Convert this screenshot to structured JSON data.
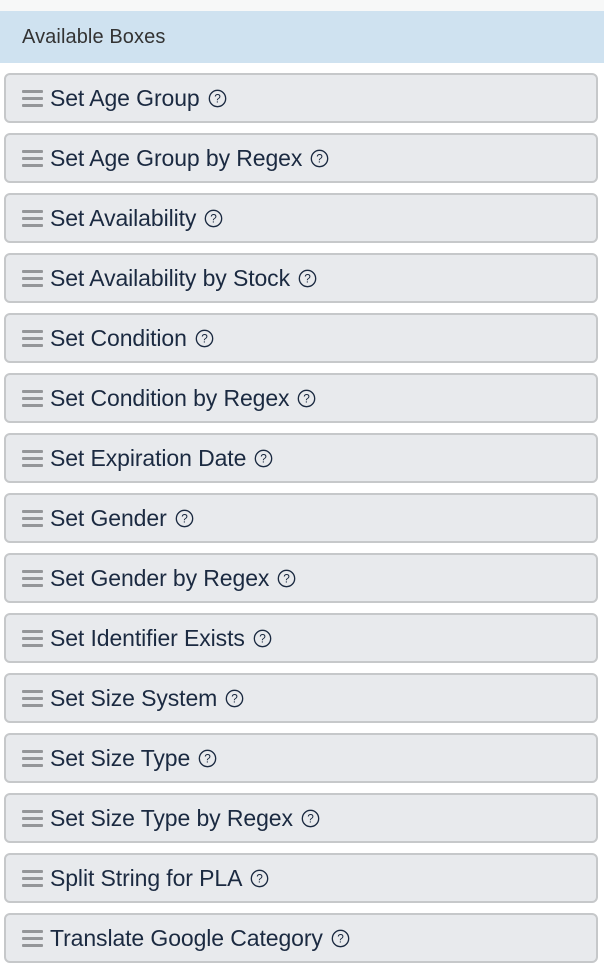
{
  "panel": {
    "header": {
      "title": "Available Boxes",
      "background_color": "#cfe2f0",
      "text_color": "#333333"
    },
    "item_style": {
      "background_color": "#e8eaed",
      "border_color": "#c6c8ca",
      "text_color": "#1b2a41",
      "handle_color": "#949699"
    },
    "items": [
      {
        "label": "Set Age Group",
        "drag_handle_icon": "drag-handle-icon",
        "help_icon": "help-circle-icon"
      },
      {
        "label": "Set Age Group by Regex",
        "drag_handle_icon": "drag-handle-icon",
        "help_icon": "help-circle-icon"
      },
      {
        "label": "Set Availability",
        "drag_handle_icon": "drag-handle-icon",
        "help_icon": "help-circle-icon"
      },
      {
        "label": "Set Availability by Stock",
        "drag_handle_icon": "drag-handle-icon",
        "help_icon": "help-circle-icon"
      },
      {
        "label": "Set Condition",
        "drag_handle_icon": "drag-handle-icon",
        "help_icon": "help-circle-icon"
      },
      {
        "label": "Set Condition by Regex",
        "drag_handle_icon": "drag-handle-icon",
        "help_icon": "help-circle-icon"
      },
      {
        "label": "Set Expiration Date",
        "drag_handle_icon": "drag-handle-icon",
        "help_icon": "help-circle-icon"
      },
      {
        "label": "Set Gender",
        "drag_handle_icon": "drag-handle-icon",
        "help_icon": "help-circle-icon"
      },
      {
        "label": "Set Gender by Regex",
        "drag_handle_icon": "drag-handle-icon",
        "help_icon": "help-circle-icon"
      },
      {
        "label": "Set Identifier Exists",
        "drag_handle_icon": "drag-handle-icon",
        "help_icon": "help-circle-icon"
      },
      {
        "label": "Set Size System",
        "drag_handle_icon": "drag-handle-icon",
        "help_icon": "help-circle-icon"
      },
      {
        "label": "Set Size Type",
        "drag_handle_icon": "drag-handle-icon",
        "help_icon": "help-circle-icon"
      },
      {
        "label": "Set Size Type by Regex",
        "drag_handle_icon": "drag-handle-icon",
        "help_icon": "help-circle-icon"
      },
      {
        "label": "Split String for PLA",
        "drag_handle_icon": "drag-handle-icon",
        "help_icon": "help-circle-icon"
      },
      {
        "label": "Translate Google Category",
        "drag_handle_icon": "drag-handle-icon",
        "help_icon": "help-circle-icon"
      }
    ]
  }
}
